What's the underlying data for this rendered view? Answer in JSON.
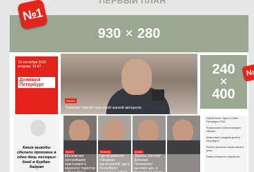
{
  "header": {
    "cut_title": "ПЕРВЫЙ ПЛАН"
  },
  "badges": {
    "top_left": "№1",
    "right_small": "№"
  },
  "top_banner": {
    "width": "930",
    "times": "×",
    "height": "280"
  },
  "right_ad": {
    "width": "240",
    "times": "×",
    "height": "400"
  },
  "promo": {
    "date_line1": "10 сентября 2016",
    "date_line2": "вторник, 12:47",
    "brand": "Деловой Петербург"
  },
  "hero": {
    "tag": "Бизнес",
    "caption": "\"Газпром\" ответил под серой шапкой автоцентр"
  },
  "caricature": {
    "text": "Какие выводы сделали прохожие в одно день пестрых дней в Курбан-байрам"
  },
  "thumbs": [
    {
      "tag": "Бизнес",
      "caption": "Московские застройщики приступают к переносу туристов в Петербурге"
    },
    {
      "tag": "Финансы",
      "caption": "Где по ремонту городских магистралей, где в Петербурге планирует в 2017 и 2018 годах"
    },
    {
      "tag": "Бизнес",
      "caption": "\"Даросс Систем\": Длинные Проморейн: высоких цен, в Петербурге стоить на 1 млрд рублей"
    }
  ],
  "news_list": [
    "Новый сезон: отдых в Санкт-Петербурге 2016",
    "Фонд вложил в реконструкцию объекта",
    "Инвестиции: продажа долей в Петербурге",
    "Рынок: строители готовы снизить цены",
    "Новости бизнеса и финансов"
  ]
}
